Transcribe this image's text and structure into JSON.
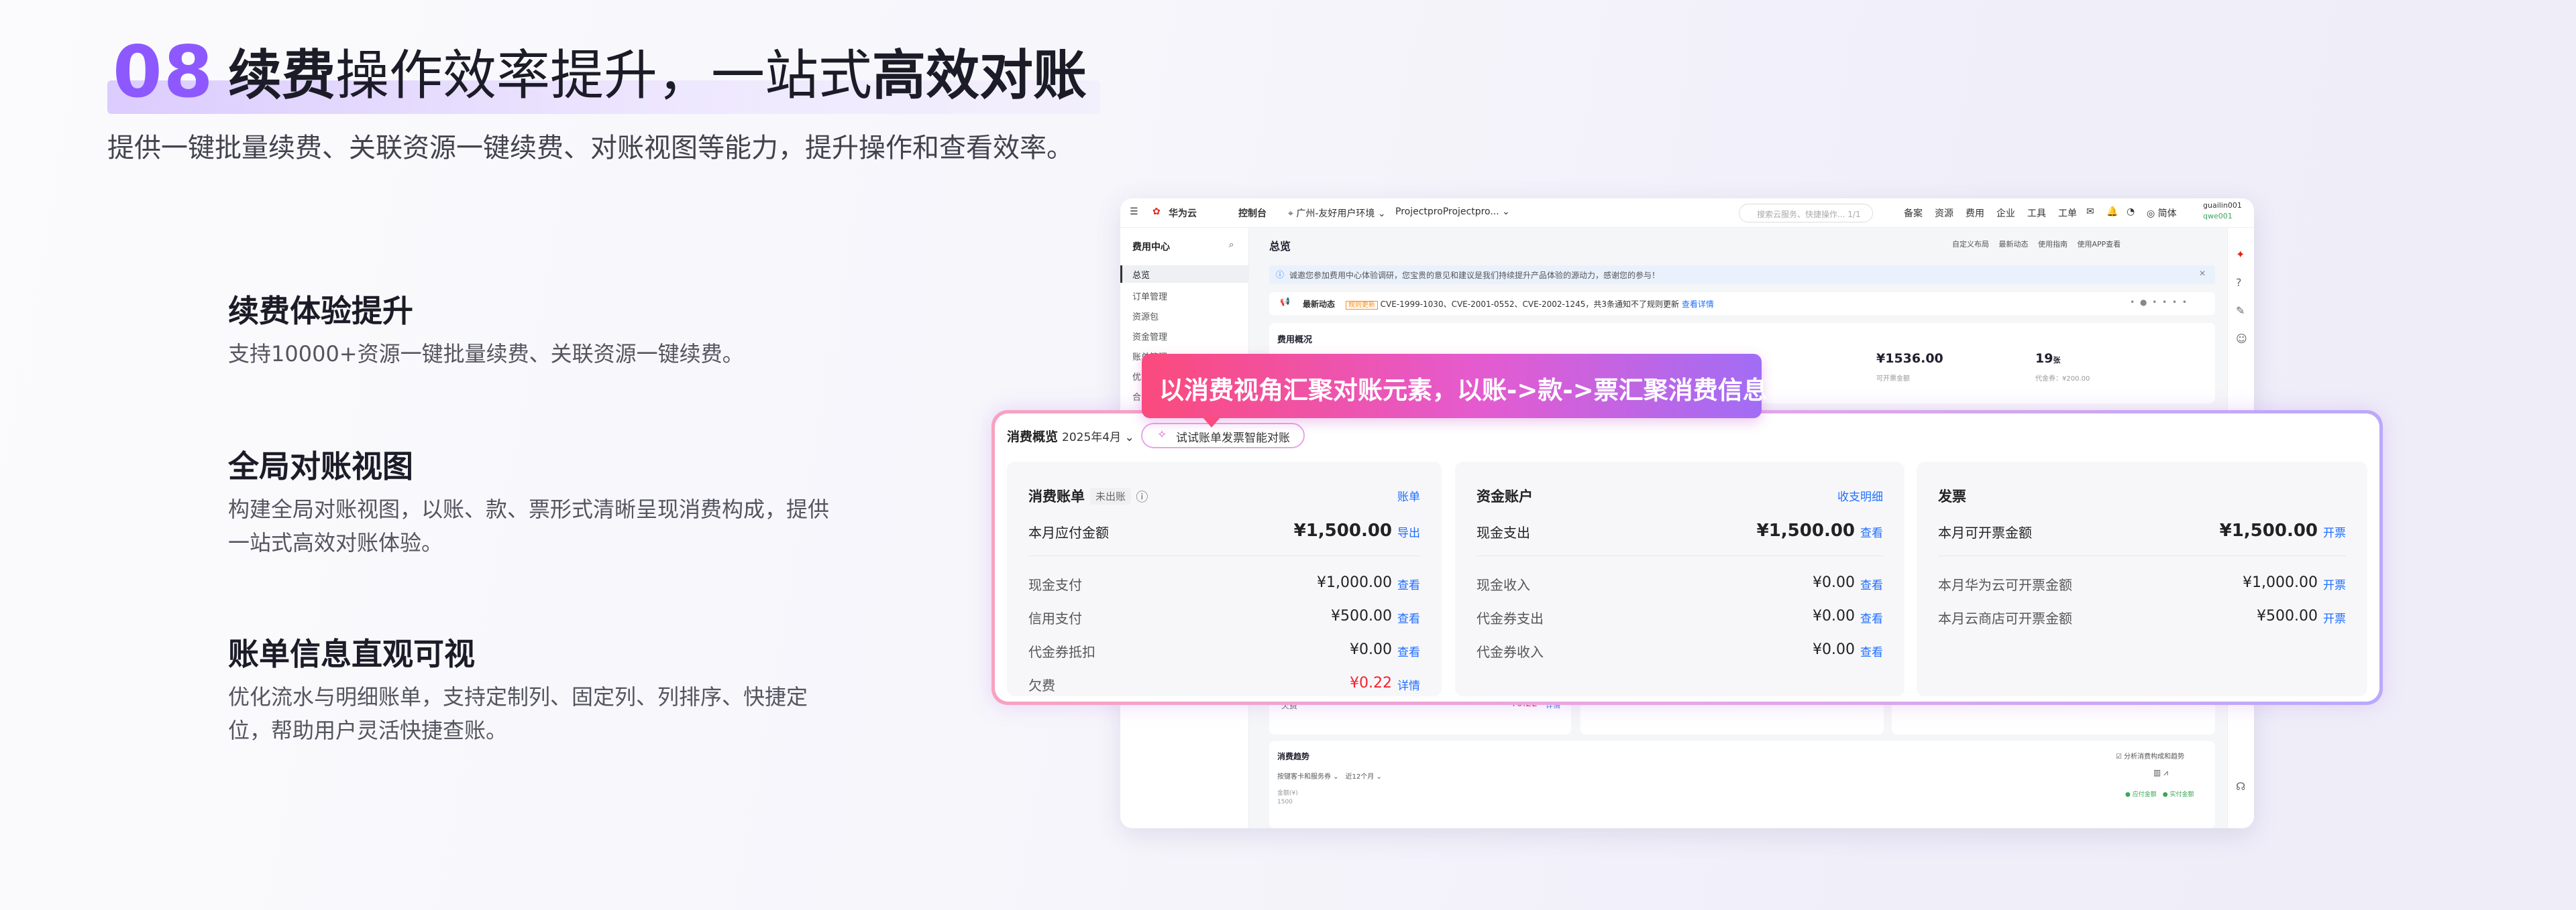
{
  "hero": {
    "number": "08",
    "title_bold1": "续费",
    "title_normal": "操作效率提升，一站式",
    "title_bold2": "高效对账",
    "subtitle": "提供一键批量续费、关联资源一键续费、对账视图等能力，提升操作和查看效率。"
  },
  "features": [
    {
      "title": "续费体验提升",
      "desc": "支持10000+资源一键批量续费、关联资源一键续费。"
    },
    {
      "title": "全局对账视图",
      "desc": "构建全局对账视图，以账、款、票形式清晰呈现消费构成，提供一站式高效对账体验。"
    },
    {
      "title": "账单信息直观可视",
      "desc": "优化流水与明细账单，支持定制列、固定列、列排序、快捷定位，帮助用户灵活快捷查账。"
    }
  ],
  "console": {
    "brand": "华为云",
    "nav_console": "控制台",
    "region": "广州-友好用户环境",
    "project": "ProjectproProjectpro...",
    "search_placeholder": "搜索云服务、快捷操作...",
    "search_shortcut": "1/1",
    "top_links": [
      "备案",
      "资源",
      "费用",
      "企业",
      "工具",
      "工单"
    ],
    "lang": "简体",
    "user": "guailin001",
    "user_sub": "qwe001",
    "sidebar_title": "费用中心",
    "sidebar_items": [
      "总览",
      "订单管理",
      "资源包",
      "资金管理",
      "账单管理",
      "优惠券",
      "合同"
    ],
    "page_title": "总览",
    "page_actions": [
      "自定义布局",
      "最新动态",
      "使用指南",
      "使用APP查看"
    ],
    "notice": "诚邀您参加费用中心体验调研，您宝贵的意见和建议是我们持续提升产品体验的源动力，感谢您的参与！",
    "dynamic_label": "最新动态",
    "dynamic_tag": "规则更新",
    "dynamic_text": "CVE-1999-1030、CVE-2001-0552、CVE-2002-1245，共3条通知不了规则更新",
    "dynamic_link": "查看详情",
    "overview_label": "费用概况",
    "cash_amount": "¥1536.00",
    "cash_label": "可开票金额",
    "count": "19",
    "count_unit": "张",
    "voucher": "代金券：¥200.00",
    "bg_debt_label": "欠费",
    "bg_debt_value": "¥0.22",
    "bg_debt_link": "详情",
    "trend_title": "消费趋势",
    "trend_filter1": "按键客卡和服务券",
    "trend_filter2": "近12个月",
    "trend_check": "分析消费构成和趋势",
    "trend_unit": "金额(¥)",
    "trend_y": "1500",
    "trend_legend": [
      "应付金额",
      "实付金额"
    ]
  },
  "bubble": "以消费视角汇聚对账元素，以账->款->票汇聚消费信息",
  "overview": {
    "title": "消费概览",
    "month": "2025年4月",
    "smart_btn": "试试账单发票智能对账",
    "bill": {
      "title": "消费账单",
      "tag": "未出账",
      "link": "账单",
      "main_label": "本月应付金额",
      "main_value": "¥1,500.00",
      "main_link": "导出",
      "rows": [
        {
          "label": "现金支付",
          "value": "¥1,000.00",
          "link": "查看"
        },
        {
          "label": "信用支付",
          "value": "¥500.00",
          "link": "查看"
        },
        {
          "label": "代金券抵扣",
          "value": "¥0.00",
          "link": "查看"
        },
        {
          "label": "欠费",
          "value": "¥0.22",
          "link": "详情"
        }
      ]
    },
    "fund": {
      "title": "资金账户",
      "link": "收支明细",
      "main_label": "现金支出",
      "main_value": "¥1,500.00",
      "main_link": "查看",
      "rows": [
        {
          "label": "现金收入",
          "value": "¥0.00",
          "link": "查看"
        },
        {
          "label": "代金券支出",
          "value": "¥0.00",
          "link": "查看"
        },
        {
          "label": "代金券收入",
          "value": "¥0.00",
          "link": "查看"
        }
      ]
    },
    "invoice": {
      "title": "发票",
      "main_label": "本月可开票金额",
      "main_value": "¥1,500.00",
      "main_link": "开票",
      "rows": [
        {
          "label": "本月华为云可开票金额",
          "value": "¥1,000.00",
          "link": "开票"
        },
        {
          "label": "本月云商店可开票金额",
          "value": "¥500.00",
          "link": "开票"
        }
      ]
    }
  },
  "colors": {
    "accent": "#8d59ff",
    "link": "#1f6fff",
    "debt": "#f5222d"
  }
}
